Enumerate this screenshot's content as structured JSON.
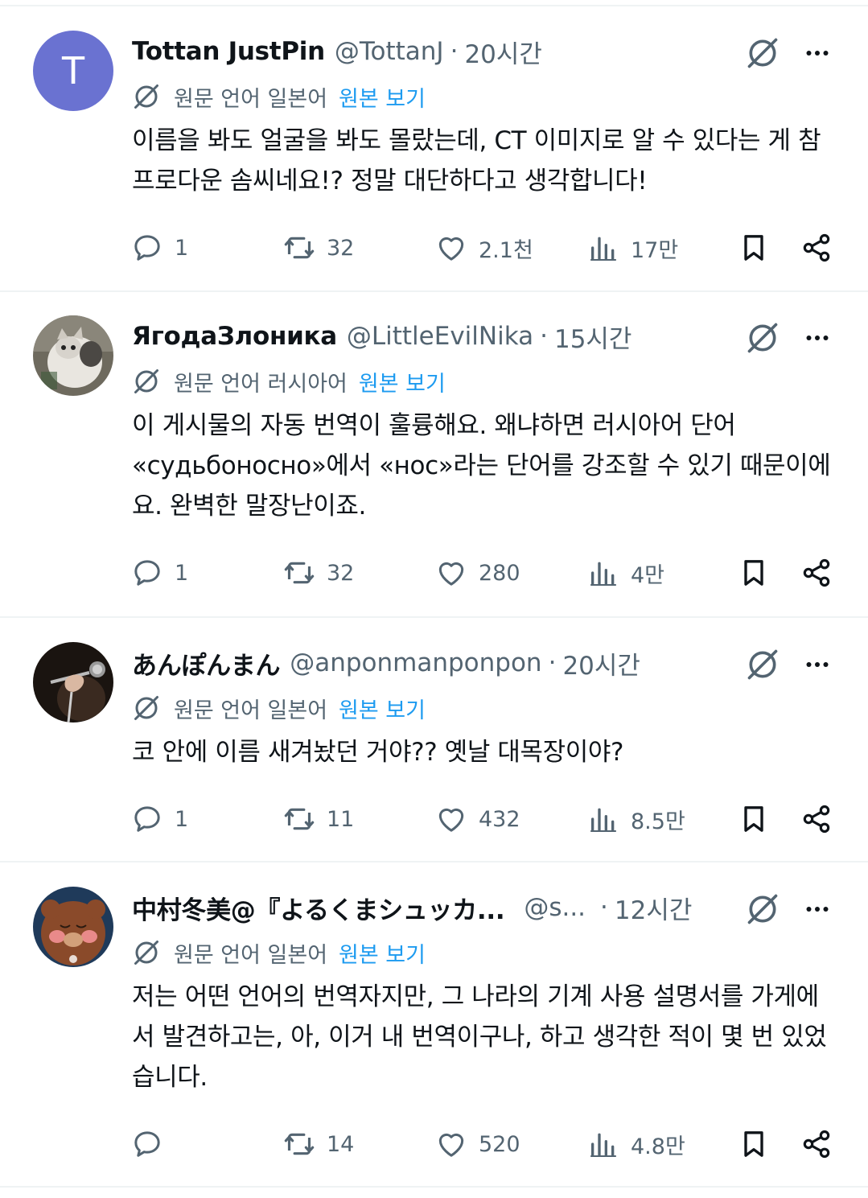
{
  "translation": {
    "view_original": "원본 보기"
  },
  "posts": [
    {
      "name": "Tottan JustPin",
      "handle": "@TottanJ",
      "time": "20시간",
      "avatar_letter": "T",
      "lang_label": "원문 언어 일본어",
      "text": "이름을 봐도 얼굴을 봐도 몰랐는데, CT 이미지로 알 수 있다는 게 참 프로다운 솜씨네요!? 정말 대단하다고 생각합니다!",
      "replies": "1",
      "reposts": "32",
      "likes": "2.1천",
      "views": "17만"
    },
    {
      "name": "ЯгодаЗлоника",
      "handle": "@LittleEvilNika",
      "time": "15시간",
      "lang_label": "원문 언어 러시아어",
      "text": "이 게시물의 자동 번역이 훌륭해요. 왜냐하면 러시아어 단어 «судьбоносно»에서 «нос»라는 단어를 강조할 수 있기 때문이에요. 완벽한 말장난이죠.",
      "replies": "1",
      "reposts": "32",
      "likes": "280",
      "views": "4만"
    },
    {
      "name": "あんぽんまん",
      "handle": "@anponmanponpon",
      "time": "20시간",
      "lang_label": "원문 언어 일본어",
      "text": "코 안에 이름 새겨놨던 거야?? 옛날 대목장이야?",
      "replies": "1",
      "reposts": "11",
      "likes": "432",
      "views": "8.5만"
    },
    {
      "name": "中村冬美@『よるくまシュッカ...",
      "handle": "@s...",
      "time": "12시간",
      "lang_label": "원문 언어 일본어",
      "text": "저는 어떤 언어의 번역자지만, 그 나라의 기계 사용 설명서를 가게에서 발견하고는, 아, 이거 내 번역이구나, 하고 생각한 적이 몇 번 있었습니다.",
      "replies": "",
      "reposts": "14",
      "likes": "520",
      "views": "4.8만"
    }
  ],
  "separator": "·",
  "colors": {
    "text": "#0f1419",
    "secondary": "#536471",
    "link": "#1d9bf0",
    "divider": "#eff3f4"
  },
  "icons": [
    "grok-icon",
    "more-icon",
    "translate-icon",
    "reply-icon",
    "repost-icon",
    "like-icon",
    "views-icon",
    "bookmark-icon",
    "share-icon"
  ]
}
